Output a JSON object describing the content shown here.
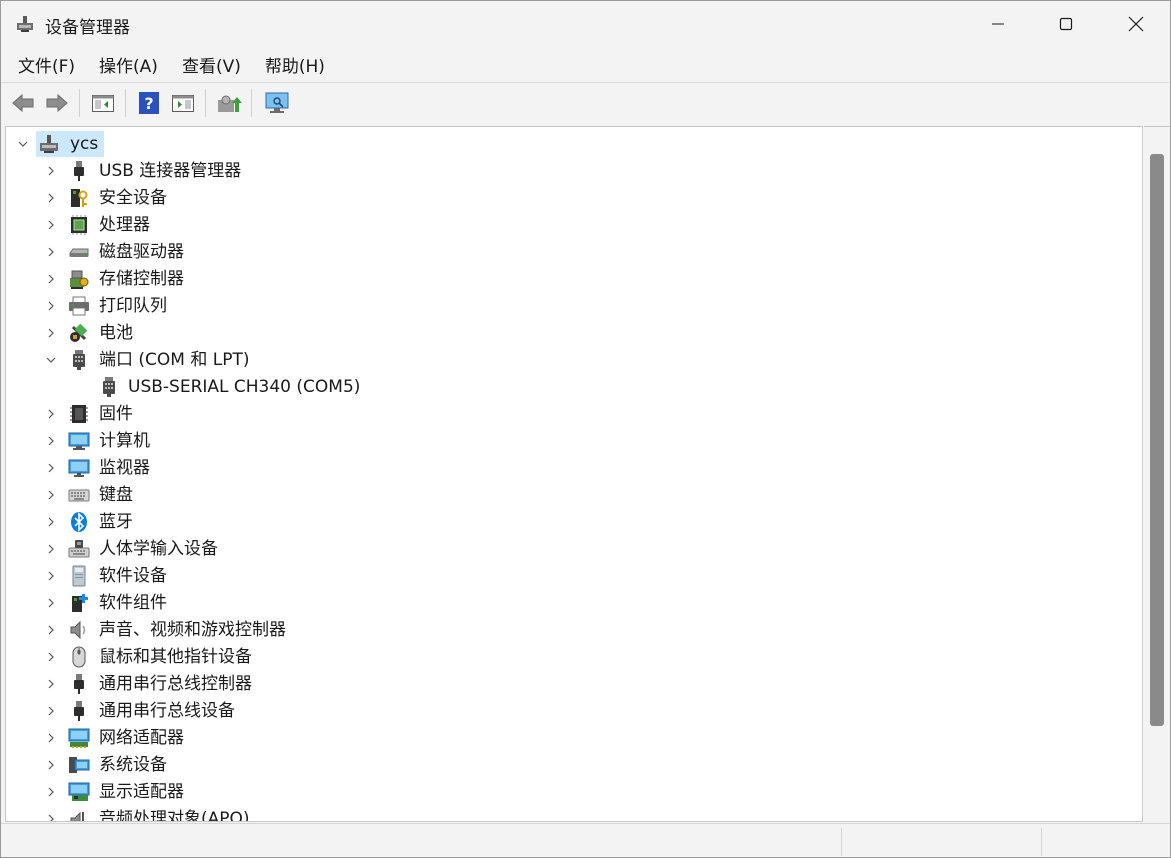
{
  "window": {
    "title": "设备管理器",
    "controls": {
      "minimize": "minimize",
      "maximize": "maximize",
      "close": "close"
    }
  },
  "menu": {
    "items": [
      {
        "label": "文件(F)"
      },
      {
        "label": "操作(A)"
      },
      {
        "label": "查看(V)"
      },
      {
        "label": "帮助(H)"
      }
    ]
  },
  "toolbar": {
    "buttons": [
      "back-icon",
      "forward-icon",
      "show-hide-tree-icon",
      "help-icon",
      "properties-icon",
      "update-driver-icon",
      "scan-hardware-icon"
    ]
  },
  "tree": {
    "root": {
      "label": "ycs",
      "icon": "computer-network-icon",
      "expanded": true,
      "selected": true
    },
    "categories": [
      {
        "label": "USB 连接器管理器",
        "icon": "usb-connector-icon",
        "expanded": false
      },
      {
        "label": "安全设备",
        "icon": "security-device-icon",
        "expanded": false
      },
      {
        "label": "处理器",
        "icon": "processor-icon",
        "expanded": false
      },
      {
        "label": "磁盘驱动器",
        "icon": "disk-drive-icon",
        "expanded": false
      },
      {
        "label": "存储控制器",
        "icon": "storage-controller-icon",
        "expanded": false
      },
      {
        "label": "打印队列",
        "icon": "printer-icon",
        "expanded": false
      },
      {
        "label": "电池",
        "icon": "battery-icon",
        "expanded": false
      },
      {
        "label": "端口 (COM 和 LPT)",
        "icon": "port-icon",
        "expanded": true,
        "children": [
          {
            "label": "USB-SERIAL CH340 (COM5)",
            "icon": "port-icon"
          }
        ]
      },
      {
        "label": "固件",
        "icon": "firmware-icon",
        "expanded": false
      },
      {
        "label": "计算机",
        "icon": "computer-icon",
        "expanded": false
      },
      {
        "label": "监视器",
        "icon": "monitor-icon",
        "expanded": false
      },
      {
        "label": "键盘",
        "icon": "keyboard-icon",
        "expanded": false
      },
      {
        "label": "蓝牙",
        "icon": "bluetooth-icon",
        "expanded": false
      },
      {
        "label": "人体学输入设备",
        "icon": "hid-icon",
        "expanded": false
      },
      {
        "label": "软件设备",
        "icon": "software-device-icon",
        "expanded": false
      },
      {
        "label": "软件组件",
        "icon": "software-component-icon",
        "expanded": false
      },
      {
        "label": "声音、视频和游戏控制器",
        "icon": "sound-icon",
        "expanded": false
      },
      {
        "label": "鼠标和其他指针设备",
        "icon": "mouse-icon",
        "expanded": false
      },
      {
        "label": "通用串行总线控制器",
        "icon": "usb-controller-icon",
        "expanded": false
      },
      {
        "label": "通用串行总线设备",
        "icon": "usb-device-icon",
        "expanded": false
      },
      {
        "label": "网络适配器",
        "icon": "network-adapter-icon",
        "expanded": false
      },
      {
        "label": "系统设备",
        "icon": "system-device-icon",
        "expanded": false
      },
      {
        "label": "显示适配器",
        "icon": "display-adapter-icon",
        "expanded": false
      },
      {
        "label": "音频处理对象(APO)",
        "icon": "audio-processing-icon",
        "expanded": false
      }
    ]
  },
  "colors": {
    "selection": "#cce8ff",
    "chrome": "#f3f3f3",
    "accent": "#0067c0"
  }
}
